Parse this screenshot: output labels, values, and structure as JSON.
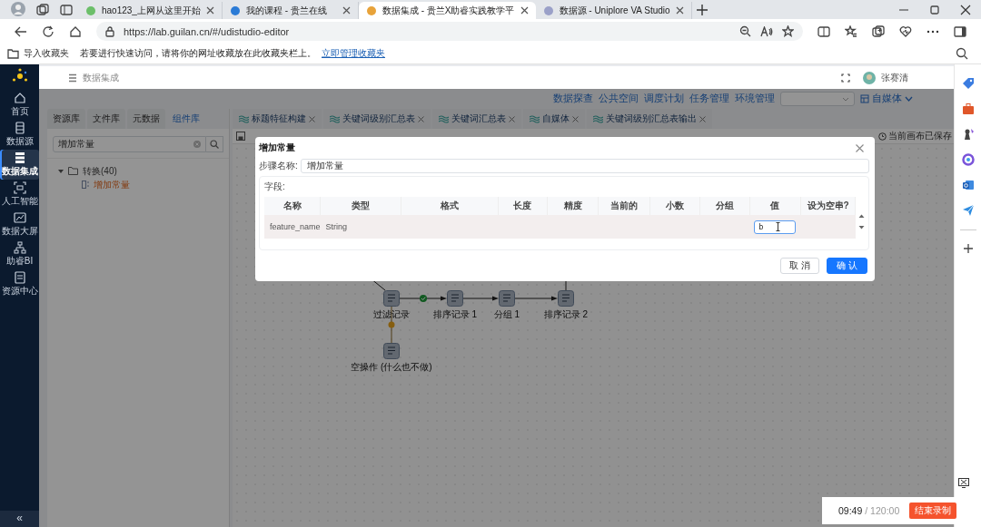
{
  "browser": {
    "tabs": [
      {
        "title": "hao123_上网从这里开始",
        "selected": false
      },
      {
        "title": "我的课程 - 贵兰在线",
        "selected": false
      },
      {
        "title": "数据集成 - 贵兰X助睿实践教学平",
        "selected": true
      },
      {
        "title": "数据源 - Uniplore VA Studio",
        "selected": false
      }
    ],
    "url": "https://lab.guilan.cn/#/udistudio-editor",
    "favorites_bar": {
      "import": "导入收藏夹",
      "hint": "若要进行快速访问，请将你的网址收藏放在此收藏夹栏上。",
      "manage_link": "立即管理收藏夹"
    }
  },
  "sidebar": {
    "items": [
      {
        "label": "首页",
        "selected": false
      },
      {
        "label": "数据源",
        "selected": false
      },
      {
        "label": "数据集成",
        "selected": true
      },
      {
        "label": "人工智能",
        "selected": false
      },
      {
        "label": "数据大屏",
        "selected": false
      },
      {
        "label": "助睿BI",
        "selected": false
      },
      {
        "label": "资源中心",
        "selected": false
      }
    ],
    "collapse": "«"
  },
  "header": {
    "title": "数据集成",
    "user": "张赛清"
  },
  "nav": {
    "links": [
      "数据探查",
      "公共空间",
      "调度计划",
      "任务管理",
      "环境管理"
    ],
    "workspace": "自媒体"
  },
  "left_panel": {
    "tabs": [
      {
        "label": "资源库",
        "selected": false
      },
      {
        "label": "文件库",
        "selected": false
      },
      {
        "label": "元数据",
        "selected": false
      },
      {
        "label": "组件库",
        "selected": true
      }
    ],
    "search": {
      "value": "增加常量"
    },
    "tree": [
      {
        "label": "转换(40)",
        "expanded": true,
        "children": [
          {
            "label": "增加常量",
            "selected": true
          }
        ]
      }
    ]
  },
  "editor": {
    "tabs": [
      {
        "title": "标题特征构建"
      },
      {
        "title": "关键词级别汇总表"
      },
      {
        "title": "关键词汇总表"
      },
      {
        "title": "自媒体"
      },
      {
        "title": "关键词级别汇总表输出"
      }
    ],
    "save_status": "当前画布已保存",
    "flow": {
      "nodes": [
        {
          "label": "过滤记录"
        },
        {
          "label": "排序记录 1"
        },
        {
          "label": "分组 1"
        },
        {
          "label": "排序记录 2"
        },
        {
          "label": "空操作 (什么也不做)"
        }
      ]
    }
  },
  "dialog": {
    "title": "增加常量",
    "step_name": {
      "label": "步骤名称:",
      "value": "增加常量"
    },
    "fields_label": "字段:",
    "columns": [
      "名称",
      "类型",
      "格式",
      "长度",
      "精度",
      "当前的",
      "小数",
      "分组",
      "值",
      "设为空串?"
    ],
    "rows": [
      {
        "name": "feature_name",
        "type": "String",
        "value": "b"
      }
    ],
    "buttons": [
      {
        "label": "取 消",
        "kind": "default"
      },
      {
        "label": "确 认",
        "kind": "primary"
      }
    ]
  },
  "recorder": {
    "elapsed": "09:49",
    "total": "/ 120:00",
    "stop_button": "结束录制"
  }
}
